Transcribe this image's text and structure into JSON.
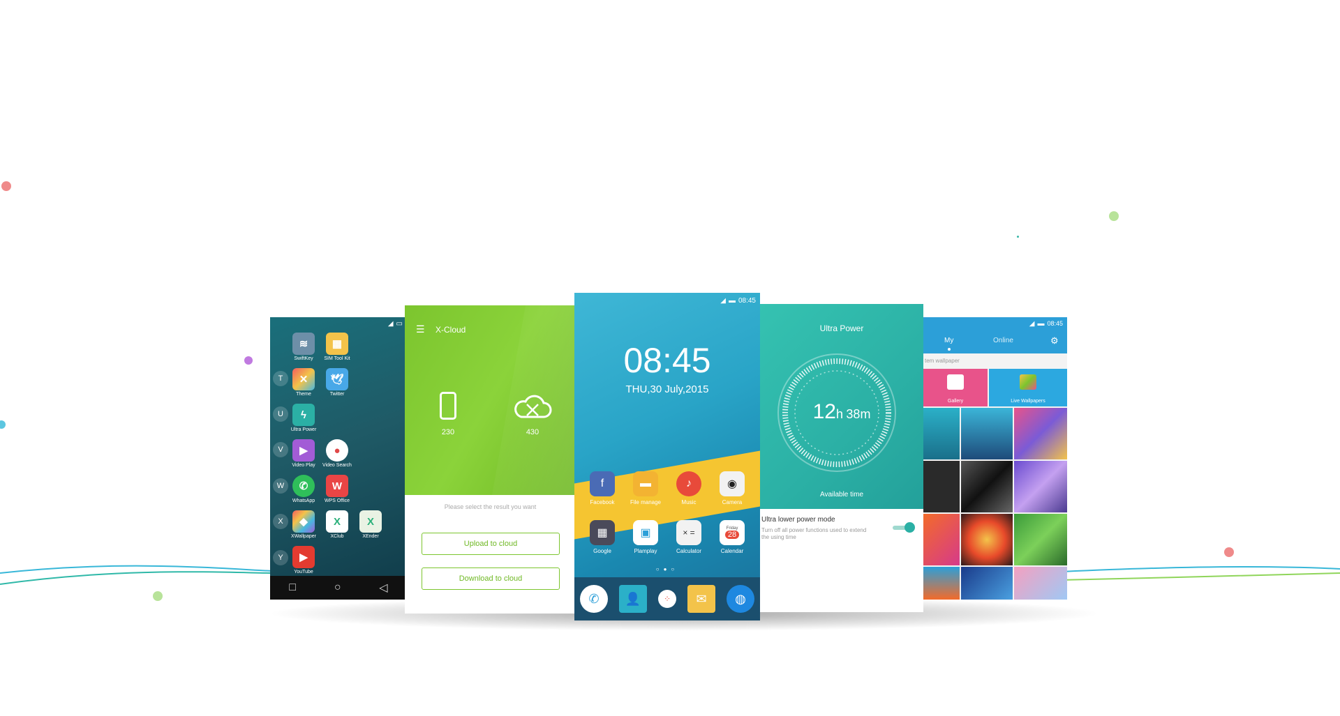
{
  "colors": {
    "cloud_green": "#7cc52e",
    "power_teal": "#2bb0a5",
    "home_blue": "#29a4c7",
    "wallpaper_blue": "#2c9fd8",
    "dot_red": "#ef8a8a",
    "dot_green": "#b8e39a",
    "dot_purple": "#c07ae0",
    "dot_cyan": "#5cc6e0"
  },
  "app_drawer": {
    "letters": [
      "T",
      "U",
      "V",
      "W",
      "X",
      "Y"
    ],
    "apps": [
      {
        "label": "SwiftKey",
        "icon": "swiftkey-icon"
      },
      {
        "label": "SIM Tool Kit",
        "icon": "sim-card-icon"
      },
      {
        "label": "Theme",
        "icon": "theme-icon"
      },
      {
        "label": "Twitter",
        "icon": "twitter-icon"
      },
      {
        "label": "Ultra Power",
        "icon": "bolt-icon"
      },
      {
        "label": "Video Play",
        "icon": "video-play-icon"
      },
      {
        "label": "Video Search",
        "icon": "microphone-icon"
      },
      {
        "label": "WhatsApp",
        "icon": "whatsapp-icon"
      },
      {
        "label": "WPS Office",
        "icon": "wps-icon"
      },
      {
        "label": "XWallpaper",
        "icon": "xwallpaper-icon"
      },
      {
        "label": "XClub",
        "icon": "xclub-icon"
      },
      {
        "label": "XEnder",
        "icon": "xender-icon"
      },
      {
        "label": "YouTube",
        "icon": "youtube-icon"
      }
    ],
    "nav_icons": [
      "recent-apps-icon",
      "home-icon",
      "back-icon"
    ]
  },
  "xcloud": {
    "title": "X-Cloud",
    "phone_count": "230",
    "cloud_count": "430",
    "hint": "Please select the result you want",
    "upload_label": "Upload to cloud",
    "download_label": "Download to cloud"
  },
  "home": {
    "status_time": "08:45",
    "clock": "08:45",
    "date": "THU,30 July,2015",
    "row1": [
      {
        "label": "Facebook",
        "icon": "facebook-icon"
      },
      {
        "label": "File manage",
        "icon": "folder-icon"
      },
      {
        "label": "Music",
        "icon": "music-icon"
      },
      {
        "label": "Camera",
        "icon": "camera-icon"
      }
    ],
    "row2": [
      {
        "label": "Google",
        "icon": "google-icon"
      },
      {
        "label": "Plamplay",
        "icon": "playstore-icon"
      },
      {
        "label": "Calculator",
        "icon": "calculator-icon"
      },
      {
        "label": "Calendar",
        "icon": "calendar-icon"
      }
    ],
    "calendar_day": "Friday",
    "calendar_date": "28",
    "dock": [
      "phone-icon",
      "contacts-icon",
      "apps-icon",
      "mail-icon",
      "browser-icon"
    ]
  },
  "power": {
    "title": "Ultra Power",
    "hours": "12",
    "h_unit": "h",
    "minutes": "38",
    "m_unit": "m",
    "available": "Available time",
    "mode_title": "Ultra lower power mode",
    "mode_desc": "Turn off all power functions used to extend the using time"
  },
  "wallpaper": {
    "status_time": "08:45",
    "tab_my": "My",
    "tab_online": "Online",
    "section": "tem wallpaper",
    "gallery": "Gallery",
    "live": "Live Wallpapers"
  }
}
